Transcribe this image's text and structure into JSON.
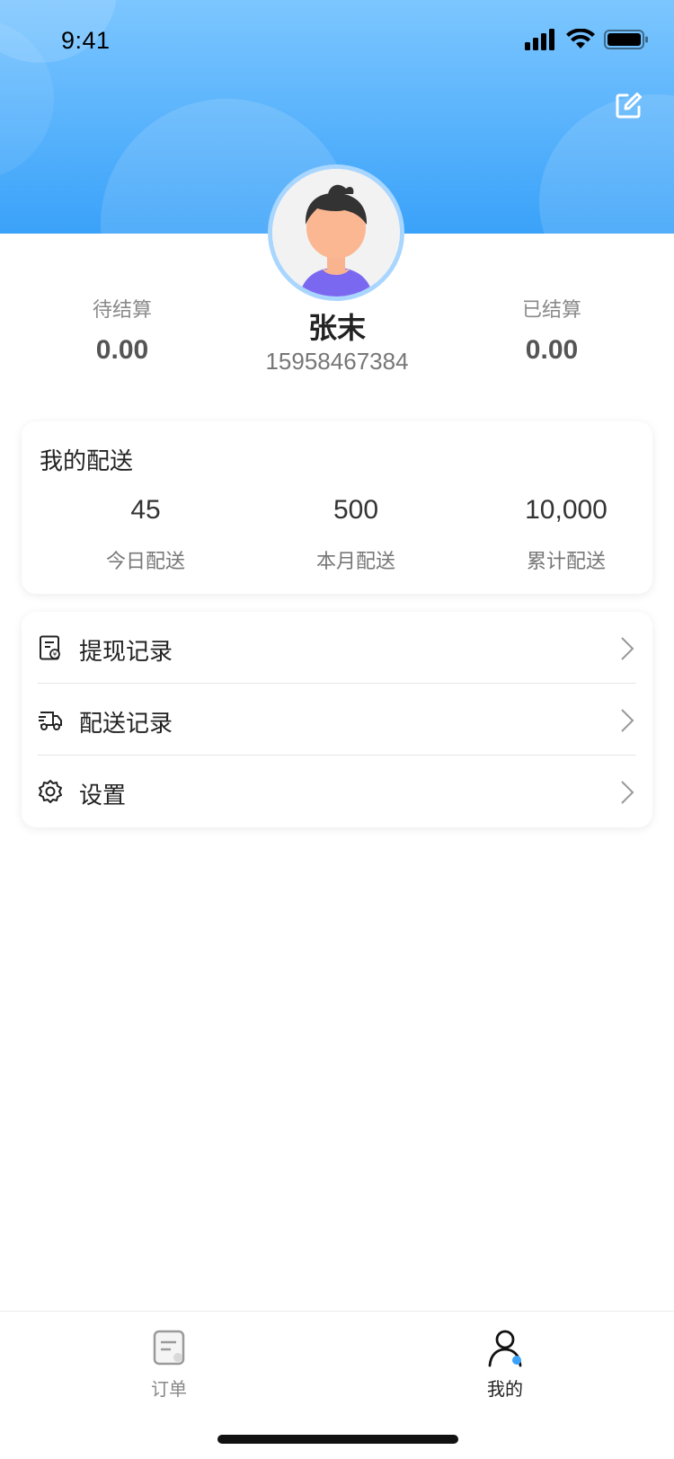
{
  "status_bar": {
    "time": "9:41"
  },
  "header": {
    "edit_icon": "edit-square-icon"
  },
  "profile": {
    "name": "张末",
    "phone": "15958467384",
    "pending": {
      "label": "待结算",
      "value": "0.00"
    },
    "settled": {
      "label": "已结算",
      "value": "0.00"
    }
  },
  "delivery": {
    "title": "我的配送",
    "metrics": [
      {
        "value": "45",
        "label": "今日配送"
      },
      {
        "value": "500",
        "label": "本月配送"
      },
      {
        "value": "10,000",
        "label": "累计配送"
      }
    ]
  },
  "menu": {
    "items": [
      {
        "label": "提现记录",
        "icon": "withdraw-record-icon"
      },
      {
        "label": "配送记录",
        "icon": "delivery-truck-icon"
      },
      {
        "label": "设置",
        "icon": "gear-icon"
      }
    ]
  },
  "tabbar": {
    "tabs": [
      {
        "label": "订单",
        "icon": "order-doc-icon",
        "active": false
      },
      {
        "label": "我的",
        "icon": "user-icon",
        "active": true
      }
    ]
  },
  "colors": {
    "header_top": "#7cc6ff",
    "header_bottom": "#3aa2f9",
    "accent": "#3aa2f9"
  }
}
